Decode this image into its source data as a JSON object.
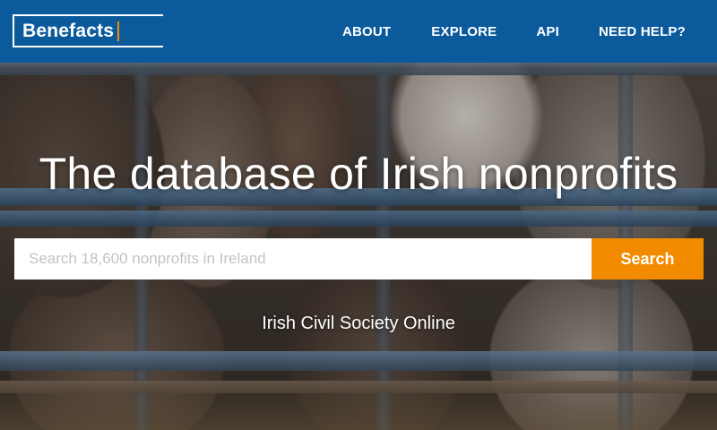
{
  "brand": {
    "logo_text": "Benefacts",
    "primary_color": "#0b5b9c",
    "accent_color": "#f28b00"
  },
  "nav": {
    "items": [
      {
        "label": "ABOUT"
      },
      {
        "label": "EXPLORE"
      },
      {
        "label": "API"
      },
      {
        "label": "NEED HELP?"
      }
    ]
  },
  "hero": {
    "title": "The database of Irish nonprofits",
    "search": {
      "placeholder": "Search 18,600 nonprofits in Ireland",
      "value": "",
      "button_label": "Search"
    },
    "tagline": "Irish Civil Society Online"
  }
}
